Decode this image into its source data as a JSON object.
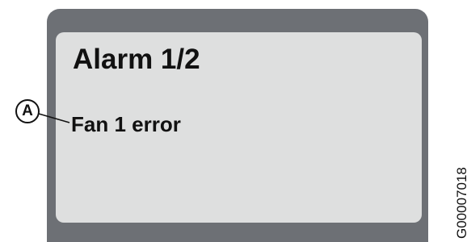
{
  "screen": {
    "title": "Alarm 1/2",
    "message": "Fan 1 error"
  },
  "callout": {
    "label": "A"
  },
  "figure_code": "G00007018",
  "colors": {
    "frame": "#6d7075",
    "screen": "#dedfdf",
    "text": "#111111"
  }
}
